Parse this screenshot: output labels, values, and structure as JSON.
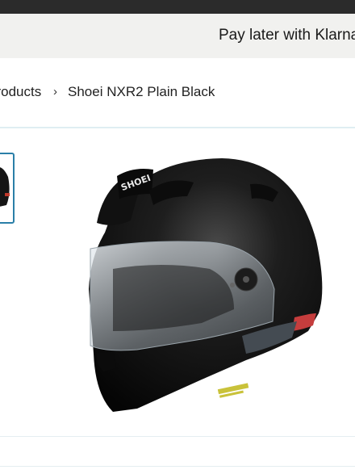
{
  "promo": {
    "text": "Pay later with Klarna"
  },
  "breadcrumb": {
    "previous": "products",
    "separator": "›",
    "current": "Shoei NXR2 Plain Black"
  },
  "product_image": {
    "brand_mark": "SHOEI"
  },
  "colors": {
    "accent": "#2a7fa8",
    "topbar": "#2b2b2b",
    "promo_bg": "#f1f1ef"
  }
}
